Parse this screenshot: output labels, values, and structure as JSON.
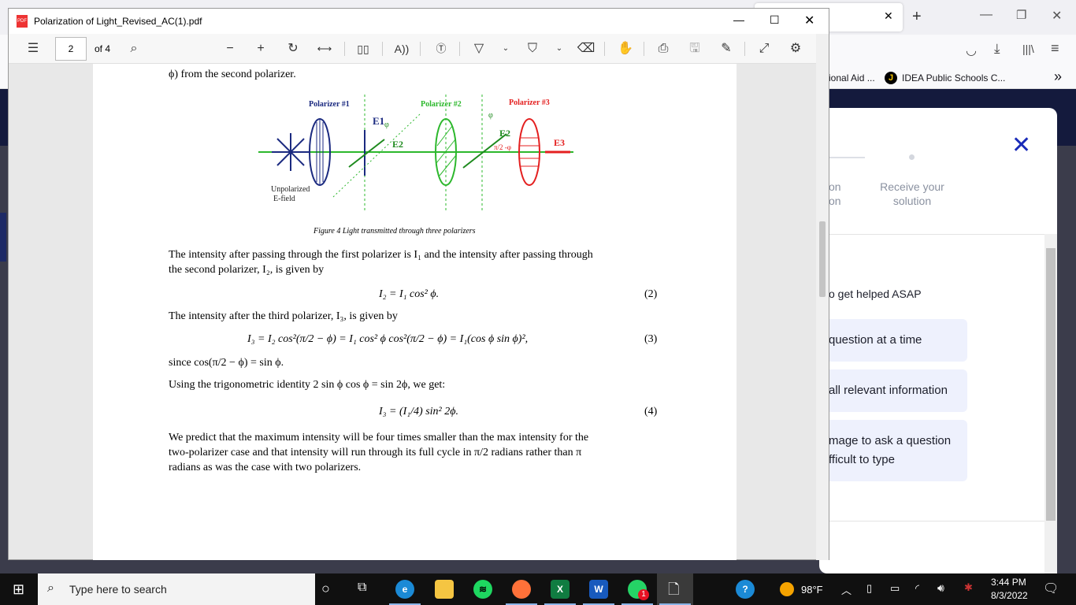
{
  "browser": {
    "bookmarks": [
      {
        "label": "ional Aid ..."
      },
      {
        "label": "IDEA Public Schools C..."
      }
    ],
    "overflow": "»",
    "new_tab": "+"
  },
  "modal": {
    "steps": [
      {
        "label_line1": "on",
        "label_line2": "on"
      },
      {
        "label_line1": "Receive your",
        "label_line2": "solution"
      }
    ],
    "tip_heading": "o get helped ASAP",
    "tips": [
      {
        "line1": "question at a time"
      },
      {
        "line1": "all relevant information"
      },
      {
        "line1": "mage to ask a question",
        "line2": "fficult to type"
      }
    ],
    "accent": "#1a2bb8"
  },
  "pdf": {
    "title": "Polarization of Light_Revised_AC(1).pdf",
    "page_number": "2",
    "page_count": "of 4",
    "content": {
      "top_line": "ϕ) from the second polarizer.",
      "figure": {
        "labels": {
          "p1": "Polarizer #1",
          "p2": "Polarizer #2",
          "p3": "Polarizer #3",
          "unpolarized1": "Unpolarized",
          "unpolarized2": "E-field",
          "e1": "E1",
          "e2": "E2",
          "e2b": "E2",
          "e3": "E3",
          "phi": "φ",
          "phi2": "φ",
          "angle": "π/2 -φ"
        },
        "caption": "Figure 4 Light transmitted through three polarizers"
      },
      "p1_line1": "The intensity after passing through the first polarizer is I₁ and the intensity after passing through",
      "p1_line2": "the second polarizer, I₂, is given by",
      "eq2": "I₂ = I₁ cos² ϕ.",
      "eq2_num": "(2)",
      "p2": "The intensity after the third polarizer, I₃, is given by",
      "eq3": "I₃ = I₂ cos²(π/2 − ϕ) = I₁ cos² ϕ cos²(π/2 − ϕ) = I₁(cos ϕ sin ϕ)²,",
      "eq3_num": "(3)",
      "p3": "since cos(π/2 − ϕ) = sin ϕ.",
      "p4": "Using the trigonometric identity 2 sin ϕ cos ϕ = sin 2ϕ, we get:",
      "eq4": "I₃ = (I₁/4) sin² 2ϕ.",
      "eq4_num": "(4)",
      "p5_line1": "We predict that the maximum intensity will be four times smaller than the max intensity for the",
      "p5_line2": "two-polarizer case and that intensity will run through its full cycle in π/2 radians rather than π",
      "p5_line3": "radians as was the case with two polarizers."
    }
  },
  "taskbar": {
    "search_placeholder": "Type here to search",
    "weather": "98°F",
    "time": "3:44 PM",
    "date": "8/3/2022",
    "whatsapp_badge": "1"
  }
}
